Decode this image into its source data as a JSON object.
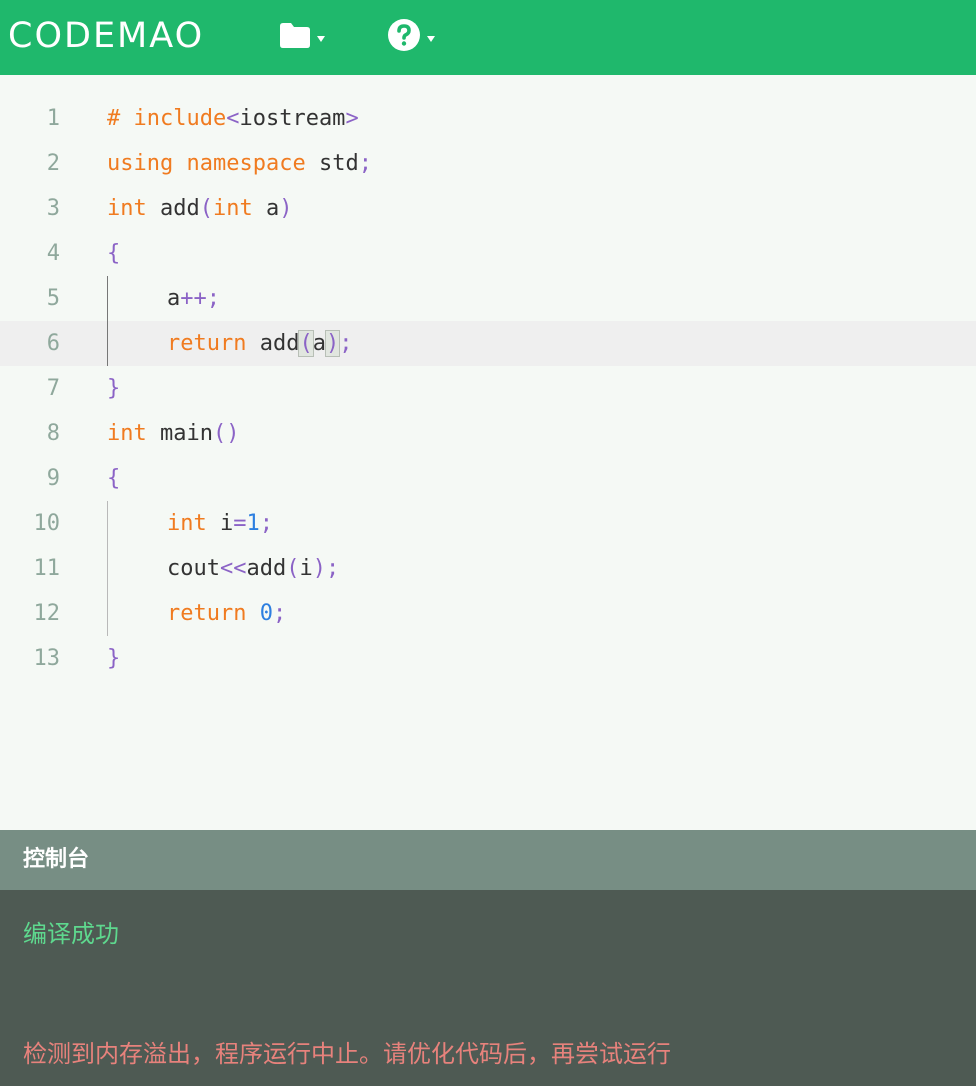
{
  "app": {
    "logo": "CODEMAO",
    "brand_color": "#1fb86c"
  },
  "toolbar": {
    "file_menu_icon": "folder-icon",
    "help_menu_icon": "help-circle-icon"
  },
  "editor": {
    "active_line": 6,
    "lines": [
      {
        "n": "1",
        "tokens": [
          [
            "kw",
            "# include"
          ],
          [
            "pun",
            "<"
          ],
          [
            "id",
            "iostream"
          ],
          [
            "pun",
            ">"
          ]
        ]
      },
      {
        "n": "2",
        "tokens": [
          [
            "kw",
            "using"
          ],
          [
            "id",
            " "
          ],
          [
            "kw",
            "namespace"
          ],
          [
            "id",
            " std"
          ],
          [
            "pun",
            ";"
          ]
        ]
      },
      {
        "n": "3",
        "tokens": [
          [
            "kw",
            "int"
          ],
          [
            "id",
            " add"
          ],
          [
            "pun",
            "("
          ],
          [
            "kw",
            "int"
          ],
          [
            "id",
            " a"
          ],
          [
            "pun",
            ")"
          ]
        ]
      },
      {
        "n": "4",
        "tokens": [
          [
            "pun",
            "{"
          ]
        ]
      },
      {
        "n": "5",
        "indent": true,
        "tokens": [
          [
            "id",
            "a"
          ],
          [
            "pun",
            "++;"
          ]
        ]
      },
      {
        "n": "6",
        "indent": true,
        "tokens": [
          [
            "kw",
            "return"
          ],
          [
            "id",
            " add"
          ],
          [
            "pun hl",
            "("
          ],
          [
            "id",
            "a"
          ],
          [
            "pun hl",
            ")"
          ],
          [
            "pun",
            ";"
          ]
        ]
      },
      {
        "n": "7",
        "tokens": [
          [
            "pun",
            "}"
          ]
        ]
      },
      {
        "n": "8",
        "tokens": [
          [
            "kw",
            "int"
          ],
          [
            "id",
            " main"
          ],
          [
            "pun",
            "()"
          ]
        ]
      },
      {
        "n": "9",
        "tokens": [
          [
            "pun",
            "{"
          ]
        ]
      },
      {
        "n": "10",
        "indent": true,
        "tokens": [
          [
            "kw",
            "int"
          ],
          [
            "id",
            " i"
          ],
          [
            "pun",
            "="
          ],
          [
            "num",
            "1"
          ],
          [
            "pun",
            ";"
          ]
        ]
      },
      {
        "n": "11",
        "indent": true,
        "tokens": [
          [
            "id",
            "cout"
          ],
          [
            "pun",
            "<<"
          ],
          [
            "id",
            "add"
          ],
          [
            "pun",
            "("
          ],
          [
            "id",
            "i"
          ],
          [
            "pun",
            ");"
          ]
        ]
      },
      {
        "n": "12",
        "indent": true,
        "tokens": [
          [
            "kw",
            "return"
          ],
          [
            "id",
            " "
          ],
          [
            "num",
            "0"
          ],
          [
            "pun",
            ";"
          ]
        ]
      },
      {
        "n": "13",
        "tokens": [
          [
            "pun",
            "}"
          ]
        ]
      }
    ]
  },
  "console": {
    "title": "控制台",
    "success_message": "编译成功",
    "error_message": "检测到内存溢出，程序运行中止。请优化代码后，再尝试运行"
  }
}
